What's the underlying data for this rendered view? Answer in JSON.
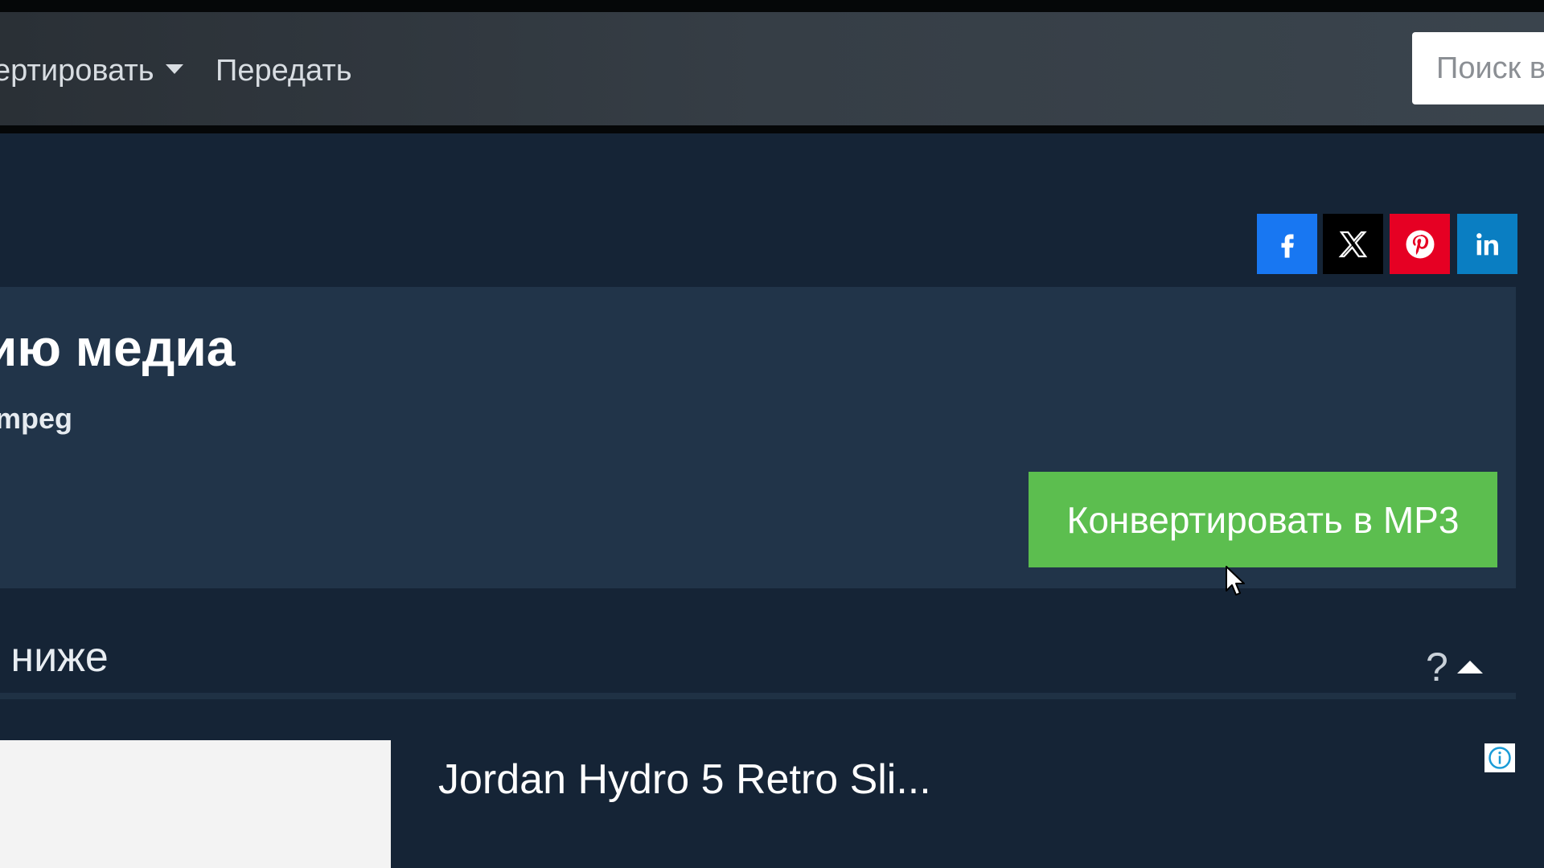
{
  "navbar": {
    "convert_label": "ертировать",
    "transfer_label": "Передать",
    "search_placeholder": "Поиск в"
  },
  "social": {
    "facebook_icon": "facebook-icon",
    "x_icon": "x-icon",
    "pinterest_icon": "pinterest-icon",
    "linkedin_icon": "linkedin-icon",
    "colors": {
      "facebook": "#1877f2",
      "x": "#000000",
      "pinterest": "#e60023",
      "linkedin": "#0a7ec2"
    }
  },
  "card": {
    "title": "ию медиа",
    "subtitle": "mpeg",
    "convert_button_label": "Конвертировать в MP3",
    "accent_color": "#5cbe4f"
  },
  "section": {
    "title": "о ниже",
    "help_symbol": "?"
  },
  "ad": {
    "title": "Jordan Hydro 5 Retro Sli..."
  }
}
